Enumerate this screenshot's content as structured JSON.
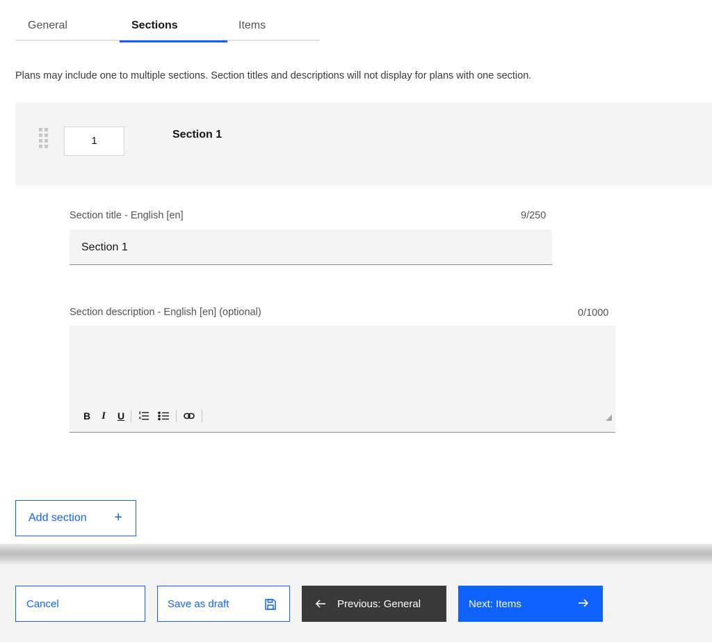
{
  "tabs": [
    {
      "label": "General",
      "active": false
    },
    {
      "label": "Sections",
      "active": true
    },
    {
      "label": "Items",
      "active": false
    }
  ],
  "intro_text": "Plans may include one to multiple sections. Section titles and descriptions will not display for plans with one section.",
  "section": {
    "order_value": "1",
    "heading": "Section 1",
    "title_field": {
      "label": "Section title - English [en]",
      "counter": "9/250",
      "value": "Section 1"
    },
    "description_field": {
      "label": "Section description - English [en] (optional)",
      "counter": "0/1000",
      "value": "",
      "toolbar": {
        "bold": "B",
        "italic": "I",
        "underline": "U"
      }
    }
  },
  "add_section_label": "Add section",
  "add_section_icon": "+",
  "footer": {
    "cancel_label": "Cancel",
    "save_draft_label": "Save as draft",
    "previous_label": "Previous: General",
    "next_label": "Next: Items"
  },
  "colors": {
    "primary": "#0f62fe",
    "dark_button": "#393939",
    "field_bg": "#f4f4f4"
  },
  "icons": {
    "drag_handle": "drag-handle-icon",
    "numbered_list": "numbered-list-icon",
    "bulleted_list": "bulleted-list-icon",
    "link": "link-icon",
    "save": "save-icon",
    "arrow_left": "arrow-left-icon",
    "arrow_right": "arrow-right-icon"
  }
}
